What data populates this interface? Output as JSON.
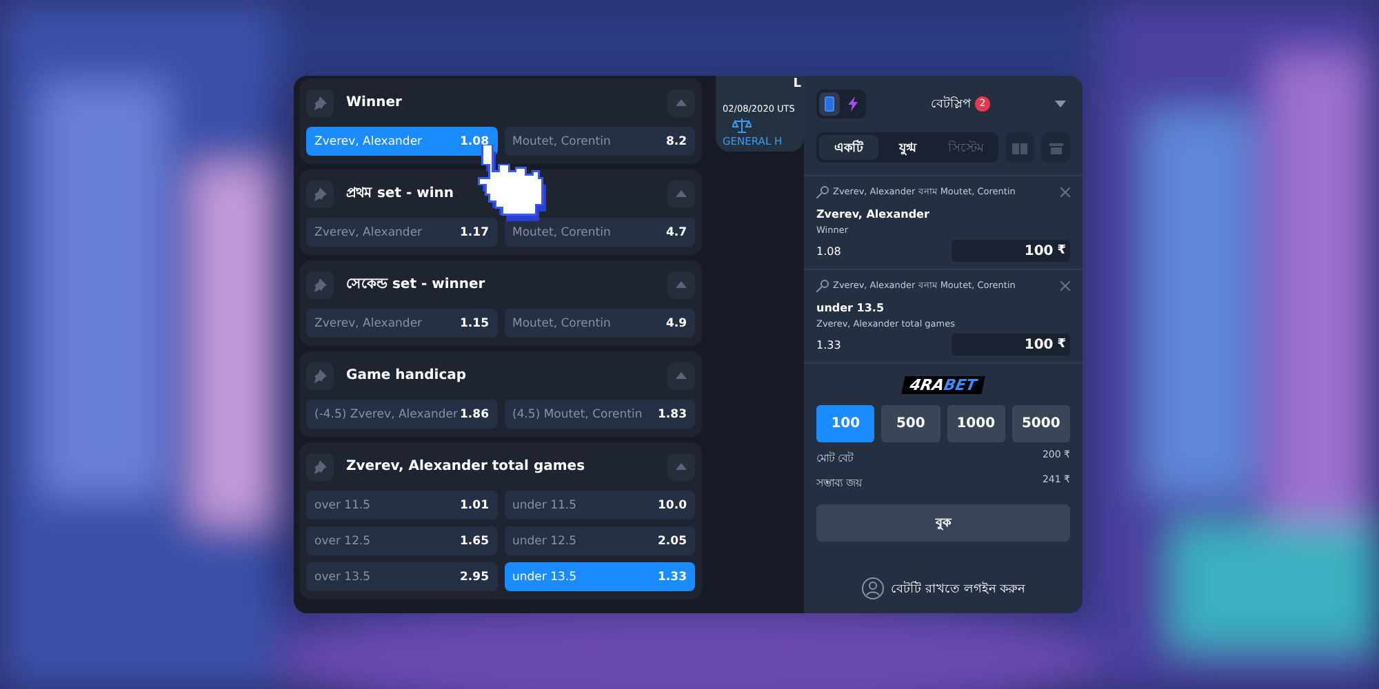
{
  "markets": [
    {
      "title": "Winner",
      "outcomes": [
        {
          "label": "Zverev, Alexander",
          "odds": "1.08",
          "selected": true
        },
        {
          "label": "Moutet, Corentin",
          "odds": "8.2",
          "selected": false
        }
      ]
    },
    {
      "title": "প্রথম set - winn",
      "outcomes": [
        {
          "label": "Zverev, Alexander",
          "odds": "1.17",
          "selected": false
        },
        {
          "label": "Moutet, Corentin",
          "odds": "4.7",
          "selected": false
        }
      ]
    },
    {
      "title": "সেকেন্ড set - winner",
      "outcomes": [
        {
          "label": "Zverev, Alexander",
          "odds": "1.15",
          "selected": false
        },
        {
          "label": "Moutet, Corentin",
          "odds": "4.9",
          "selected": false
        }
      ]
    },
    {
      "title": "Game handicap",
      "outcomes": [
        {
          "label": "(-4.5) Zverev, Alexander",
          "odds": "1.86",
          "selected": false
        },
        {
          "label": "(4.5) Moutet, Corentin",
          "odds": "1.83",
          "selected": false
        }
      ]
    },
    {
      "title": "Zverev, Alexander total games",
      "outcomes": [
        {
          "label": "over 11.5",
          "odds": "1.01",
          "selected": false
        },
        {
          "label": "under 11.5",
          "odds": "10.0",
          "selected": false
        },
        {
          "label": "over 12.5",
          "odds": "1.65",
          "selected": false
        },
        {
          "label": "under 12.5",
          "odds": "2.05",
          "selected": false
        },
        {
          "label": "over 13.5",
          "odds": "2.95",
          "selected": false
        },
        {
          "label": "under 13.5",
          "odds": "1.33",
          "selected": true
        }
      ]
    }
  ],
  "event": {
    "title": "L",
    "date": "02/08/2020 UTS",
    "tab": "GENERAL H"
  },
  "betslip": {
    "modes": [
      {
        "kind": "phone",
        "selected": true
      },
      {
        "kind": "lightning",
        "selected": false
      }
    ],
    "title": "বেটস্লিপ",
    "count": "2",
    "tabs": [
      {
        "label": "একটি",
        "selected": true
      },
      {
        "label": "যুগ্ম",
        "selected": false
      },
      {
        "label": "সিস্টেম",
        "selected": false
      }
    ],
    "bets": [
      {
        "match": "Zverev, Alexander বনাম Moutet, Corentin",
        "pick": "Zverev, Alexander",
        "market": "Winner",
        "odds": "1.08",
        "stake": "100",
        "currency": "₹"
      },
      {
        "match": "Zverev, Alexander বনাম Moutet, Corentin",
        "pick": "under 13.5",
        "market": "Zverev, Alexander total games",
        "odds": "1.33",
        "stake": "100",
        "currency": "₹"
      }
    ],
    "logo": {
      "left": "4RA",
      "right": "BET"
    },
    "amounts": [
      {
        "label": "100",
        "selected": true
      },
      {
        "label": "500",
        "selected": false
      },
      {
        "label": "1000",
        "selected": false
      },
      {
        "label": "5000",
        "selected": false
      }
    ],
    "totals": [
      {
        "label": "মোট বেট",
        "value": "200 ₹"
      },
      {
        "label": "সম্ভাব্য জয়",
        "value": "241 ₹"
      }
    ],
    "book": "বুক",
    "login": "বেটটি রাখতে লগইন করুন"
  }
}
